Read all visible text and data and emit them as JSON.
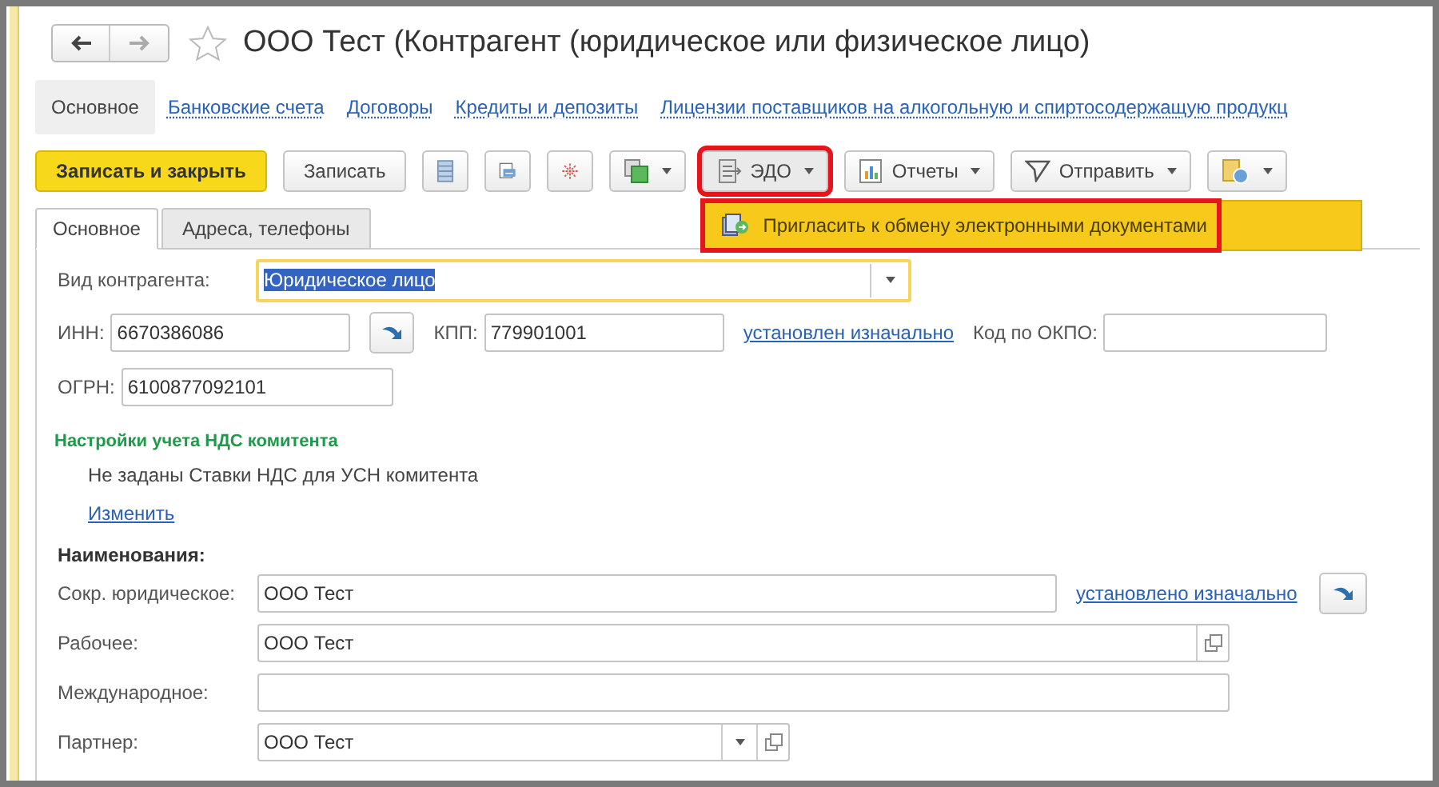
{
  "window": {
    "title": "ООО Тест (Контрагент (юридическое или физическое лицо)"
  },
  "sections": [
    {
      "label": "Основное",
      "selected": true
    },
    {
      "label": "Банковские счета",
      "selected": false
    },
    {
      "label": "Договоры",
      "selected": false
    },
    {
      "label": "Кредиты и депозиты",
      "selected": false
    },
    {
      "label": "Лицензии поставщиков на алкогольную и спиртосодержащую продукц",
      "selected": false
    }
  ],
  "toolbar": [
    {
      "kind": "primary",
      "label": "Записать и закрыть"
    },
    {
      "kind": "text",
      "label": "Записать"
    },
    {
      "kind": "icon"
    },
    {
      "kind": "icon"
    },
    {
      "kind": "icon"
    },
    {
      "kind": "icon_menu"
    },
    {
      "kind": "menu",
      "label": "ЭДО",
      "highlighted": true
    },
    {
      "kind": "menu",
      "label": "Отчеты",
      "highlighted": false
    },
    {
      "kind": "menu",
      "label": "Отправить",
      "highlighted": false
    },
    {
      "kind": "icon_menu"
    }
  ],
  "edo_menu": {
    "items": [
      {
        "label": "Пригласить к обмену электронными документами",
        "highlighted": true
      }
    ]
  },
  "form_tabs": [
    {
      "label": "Основное",
      "selected": true
    },
    {
      "label": "Адреса, телефоны",
      "selected": false
    }
  ],
  "counterparty_type": {
    "label": "Вид контрагента:",
    "value": "Юридическое лицо"
  },
  "inn": {
    "label": "ИНН:",
    "value": "6670386086"
  },
  "kpp": {
    "label": "КПП:",
    "value": "779901001",
    "link": "установлен изначально"
  },
  "okpo": {
    "label": "Код по ОКПО:"
  },
  "ogrn": {
    "label": "ОГРН:",
    "value": "6100877092101"
  },
  "vat_settings": {
    "title": "Настройки учета НДС комитента",
    "text": "Не заданы Ставки НДС для УСН комитента",
    "link": "Изменить"
  },
  "names": {
    "heading": "Наименования:",
    "fields": [
      {
        "kind": "linked",
        "label": "Сокр. юридическое:",
        "value": "ООО Тест",
        "link": "установлено изначально"
      },
      {
        "kind": "open",
        "label": "Рабочее:",
        "value": "ООО Тест"
      },
      {
        "kind": "plain",
        "label": "Международное:"
      },
      {
        "kind": "choice",
        "label": "Партнер:",
        "value": "ООО Тест"
      }
    ]
  }
}
